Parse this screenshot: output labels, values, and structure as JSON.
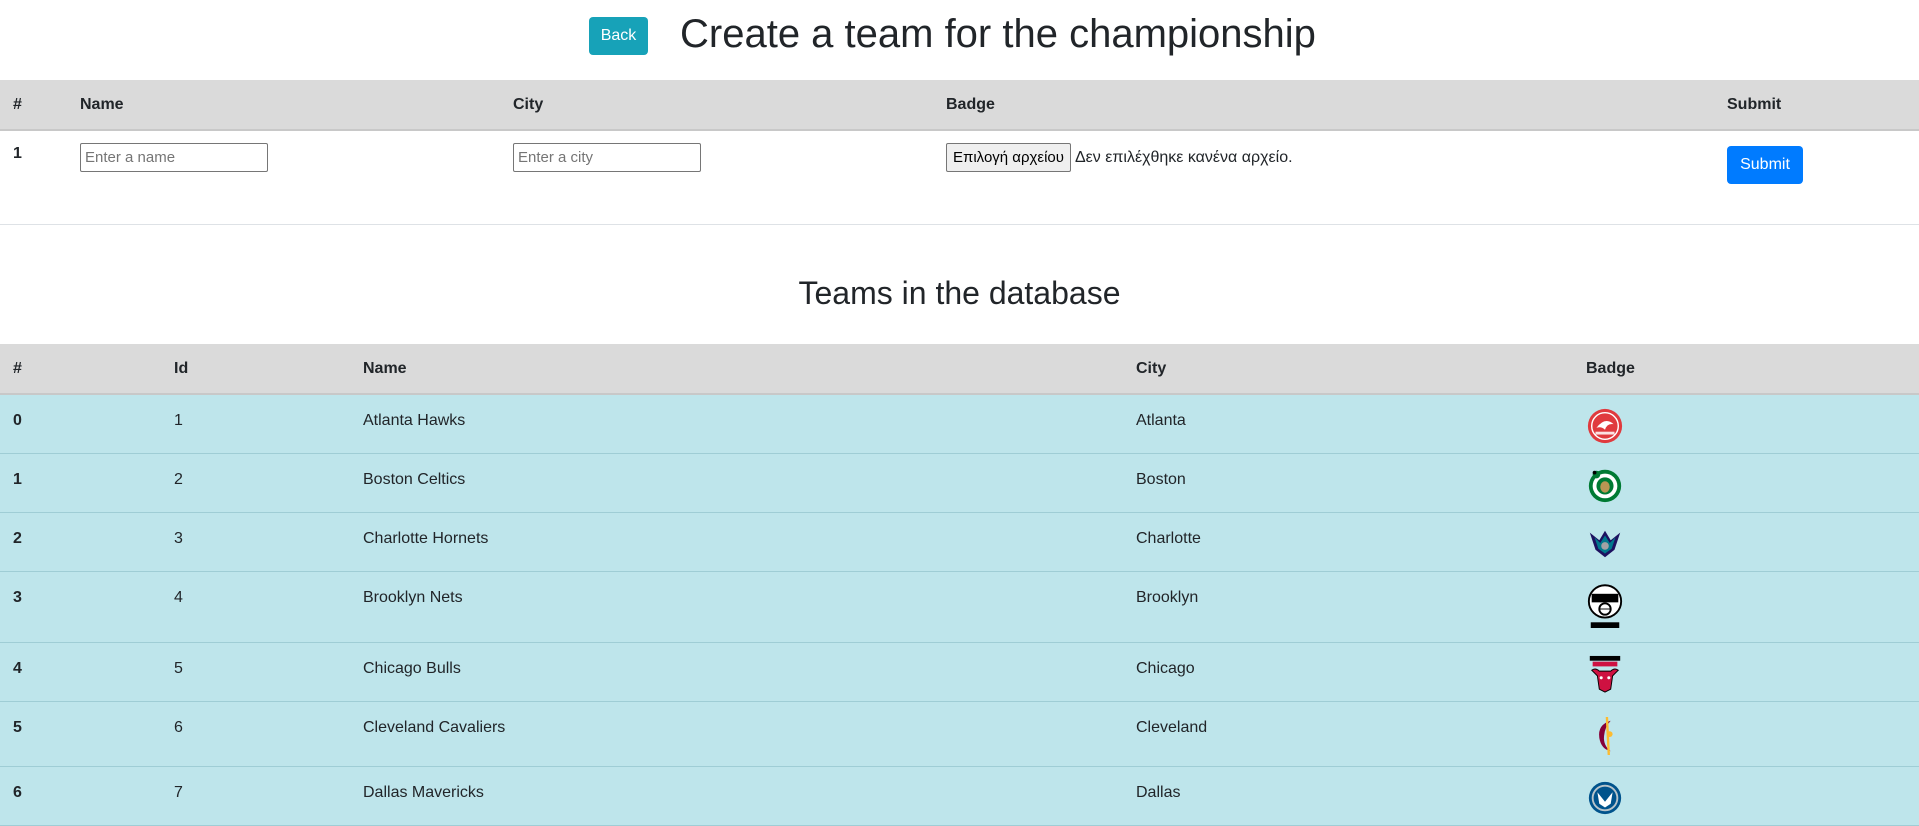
{
  "header": {
    "back_label": "Back",
    "title": "Create a team for the championship"
  },
  "form": {
    "columns": [
      "#",
      "Name",
      "City",
      "Badge",
      "Submit"
    ],
    "row_index": "1",
    "name_placeholder": "Enter a name",
    "city_placeholder": "Enter a city",
    "file_button_label": "Επιλογή αρχείου",
    "file_status": "Δεν επιλέχθηκε κανένα αρχείο.",
    "submit_label": "Submit"
  },
  "teams_section": {
    "title": "Teams in the database",
    "columns": [
      "#",
      "Id",
      "Name",
      "City",
      "Badge"
    ],
    "rows": [
      {
        "index": "0",
        "id": "1",
        "name": "Atlanta Hawks",
        "city": "Atlanta",
        "badge_icon": "atlanta-hawks-logo-icon"
      },
      {
        "index": "1",
        "id": "2",
        "name": "Boston Celtics",
        "city": "Boston",
        "badge_icon": "boston-celtics-logo-icon"
      },
      {
        "index": "2",
        "id": "3",
        "name": "Charlotte Hornets",
        "city": "Charlotte",
        "badge_icon": "charlotte-hornets-logo-icon"
      },
      {
        "index": "3",
        "id": "4",
        "name": "Brooklyn Nets",
        "city": "Brooklyn",
        "badge_icon": "brooklyn-nets-logo-icon"
      },
      {
        "index": "4",
        "id": "5",
        "name": "Chicago Bulls",
        "city": "Chicago",
        "badge_icon": "chicago-bulls-logo-icon"
      },
      {
        "index": "5",
        "id": "6",
        "name": "Cleveland Cavaliers",
        "city": "Cleveland",
        "badge_icon": "cleveland-cavaliers-logo-icon"
      },
      {
        "index": "6",
        "id": "7",
        "name": "Dallas Mavericks",
        "city": "Dallas",
        "badge_icon": "dallas-mavericks-logo-icon"
      }
    ]
  },
  "colors": {
    "back_button": "#17a2b8",
    "submit_button": "#007bff",
    "table_header": "#dadada",
    "row_info": "#bee5eb"
  }
}
